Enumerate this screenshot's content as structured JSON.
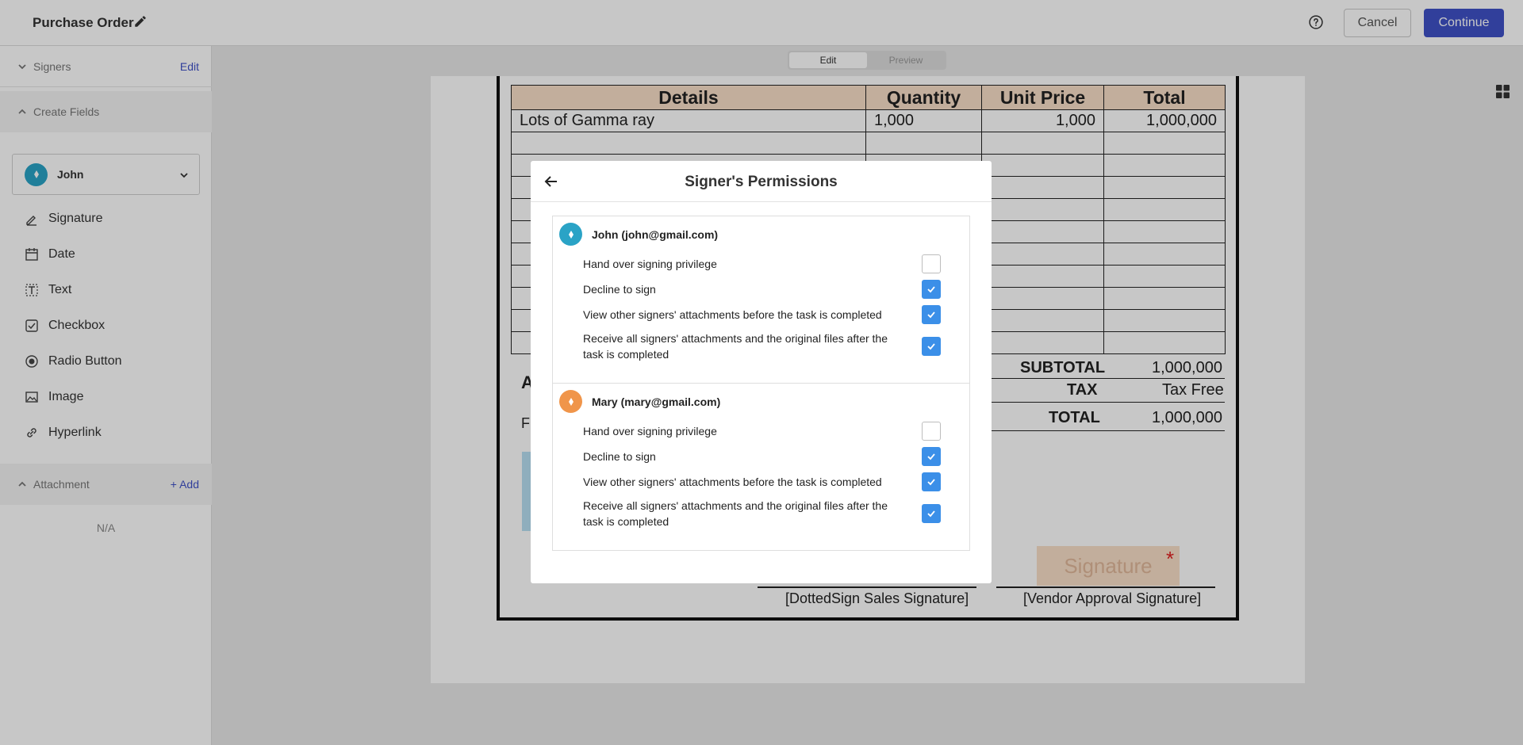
{
  "header": {
    "title": "Purchase Order",
    "cancel_label": "Cancel",
    "continue_label": "Continue"
  },
  "sidebar": {
    "signers": {
      "label": "Signers",
      "action": "Edit"
    },
    "create_fields": {
      "label": "Create Fields"
    },
    "selected_signer": "John",
    "tools": [
      {
        "label": "Signature",
        "icon": "signature-icon"
      },
      {
        "label": "Date",
        "icon": "calendar-icon"
      },
      {
        "label": "Text",
        "icon": "text-icon"
      },
      {
        "label": "Checkbox",
        "icon": "checkbox-icon"
      },
      {
        "label": "Radio Button",
        "icon": "radio-icon"
      },
      {
        "label": "Image",
        "icon": "image-icon"
      },
      {
        "label": "Hyperlink",
        "icon": "link-icon"
      }
    ],
    "attachment": {
      "label": "Attachment",
      "action": "+ Add",
      "empty": "N/A"
    }
  },
  "view_toggle": {
    "edit": "Edit",
    "preview": "Preview"
  },
  "document": {
    "columns": [
      "Details",
      "Quantity",
      "Unit Price",
      "Total"
    ],
    "rows": [
      [
        "Lots of Gamma ray",
        "1,000",
        "1,000",
        "1,000,000"
      ]
    ],
    "subtotal_label": "SUBTOTAL",
    "subtotal_value": "1,000,000",
    "tax_label": "TAX",
    "tax_value": "Tax Free",
    "total_label": "TOTAL",
    "total_value": "1,000,000",
    "partial_heading": "A",
    "partial_text": "F",
    "signature_field": "Signature",
    "sales_signature": "[DottedSign Sales Signature]",
    "vendor_signature": "[Vendor Approval Signature]"
  },
  "modal": {
    "title": "Signer's Permissions",
    "signers": [
      {
        "name": "John (john@gmail.com)",
        "color": "#2aa3c6",
        "permissions": [
          {
            "label": "Hand over signing privilege",
            "checked": false
          },
          {
            "label": "Decline to sign",
            "checked": true
          },
          {
            "label": "View other signers' attachments before the task is completed",
            "checked": true
          },
          {
            "label": "Receive all signers' attachments and the original files after the task is completed",
            "checked": true
          }
        ]
      },
      {
        "name": "Mary (mary@gmail.com)",
        "color": "#f0954a",
        "permissions": [
          {
            "label": "Hand over signing privilege",
            "checked": false
          },
          {
            "label": "Decline to sign",
            "checked": true
          },
          {
            "label": "View other signers' attachments before the task is completed",
            "checked": true
          },
          {
            "label": "Receive all signers' attachments and the original files after the task is completed",
            "checked": true
          }
        ]
      }
    ]
  }
}
